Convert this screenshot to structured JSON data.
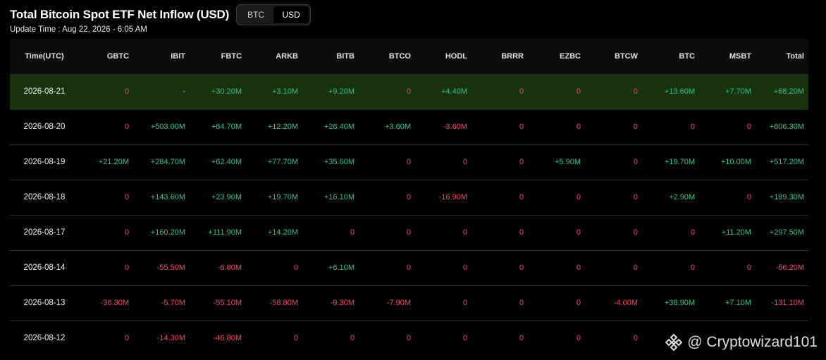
{
  "header": {
    "title": "Total Bitcoin Spot ETF Net Inflow (USD)",
    "toggle": [
      {
        "label": "BTC",
        "active": false
      },
      {
        "label": "USD",
        "active": true
      }
    ],
    "update_time": "Update Time : Aug 22, 2026 - 6:05 AM"
  },
  "table": {
    "columns": [
      "Time(UTC)",
      "GBTC",
      "IBIT",
      "FBTC",
      "ARKB",
      "BITB",
      "BTCO",
      "HODL",
      "BRRR",
      "EZBC",
      "BTCW",
      "BTC",
      "MSBT",
      "Total"
    ],
    "rows": [
      {
        "date": "2026-08-21",
        "highlight": true,
        "cells": [
          "0",
          "-",
          "+30.20M",
          "+3.10M",
          "+9.20M",
          "0",
          "+4.40M",
          "0",
          "0",
          "0",
          "+13.60M",
          "+7.70M",
          "+68.20M"
        ]
      },
      {
        "date": "2026-08-20",
        "highlight": false,
        "cells": [
          "0",
          "+503.00M",
          "+64.70M",
          "+12.20M",
          "+26.40M",
          "+3.60M",
          "-3.60M",
          "0",
          "0",
          "0",
          "0",
          "0",
          "+606.30M"
        ]
      },
      {
        "date": "2026-08-19",
        "highlight": false,
        "cells": [
          "+21.20M",
          "+284.70M",
          "+62.40M",
          "+77.70M",
          "+35.60M",
          "0",
          "0",
          "0",
          "+5.90M",
          "0",
          "+19.70M",
          "+10.00M",
          "+517.20M"
        ]
      },
      {
        "date": "2026-08-18",
        "highlight": false,
        "cells": [
          "0",
          "+143.60M",
          "+23.90M",
          "+19.70M",
          "+16.10M",
          "0",
          "-16.90M",
          "0",
          "0",
          "0",
          "+2.90M",
          "0",
          "+189.30M"
        ]
      },
      {
        "date": "2026-08-17",
        "highlight": false,
        "cells": [
          "0",
          "+160.20M",
          "+111.90M",
          "+14.20M",
          "0",
          "0",
          "0",
          "0",
          "0",
          "0",
          "0",
          "+11.20M",
          "+297.50M"
        ]
      },
      {
        "date": "2026-08-14",
        "highlight": false,
        "cells": [
          "0",
          "-55.50M",
          "-6.80M",
          "0",
          "+6.10M",
          "0",
          "0",
          "0",
          "0",
          "0",
          "0",
          "0",
          "-56.20M"
        ]
      },
      {
        "date": "2026-08-13",
        "highlight": false,
        "cells": [
          "-36.30M",
          "-5.70M",
          "-55.10M",
          "-58.80M",
          "-9.30M",
          "-7.90M",
          "0",
          "0",
          "0",
          "-4.00M",
          "+38.90M",
          "+7.10M",
          "-131.10M"
        ]
      },
      {
        "date": "2026-08-12",
        "highlight": false,
        "cells": [
          "0",
          "-14.30M",
          "-46.80M",
          "0",
          "0",
          "0",
          "0",
          "0",
          "0",
          "0",
          "",
          "",
          ""
        ]
      }
    ]
  },
  "watermark": {
    "text": "@ Cryptowizard101",
    "icon": "binance-logo-icon"
  },
  "colors": {
    "positive": "#33c57f",
    "negative": "#f6465d",
    "zero": "#f6465d",
    "highlight_row": "#18340f",
    "background": "#000000"
  }
}
